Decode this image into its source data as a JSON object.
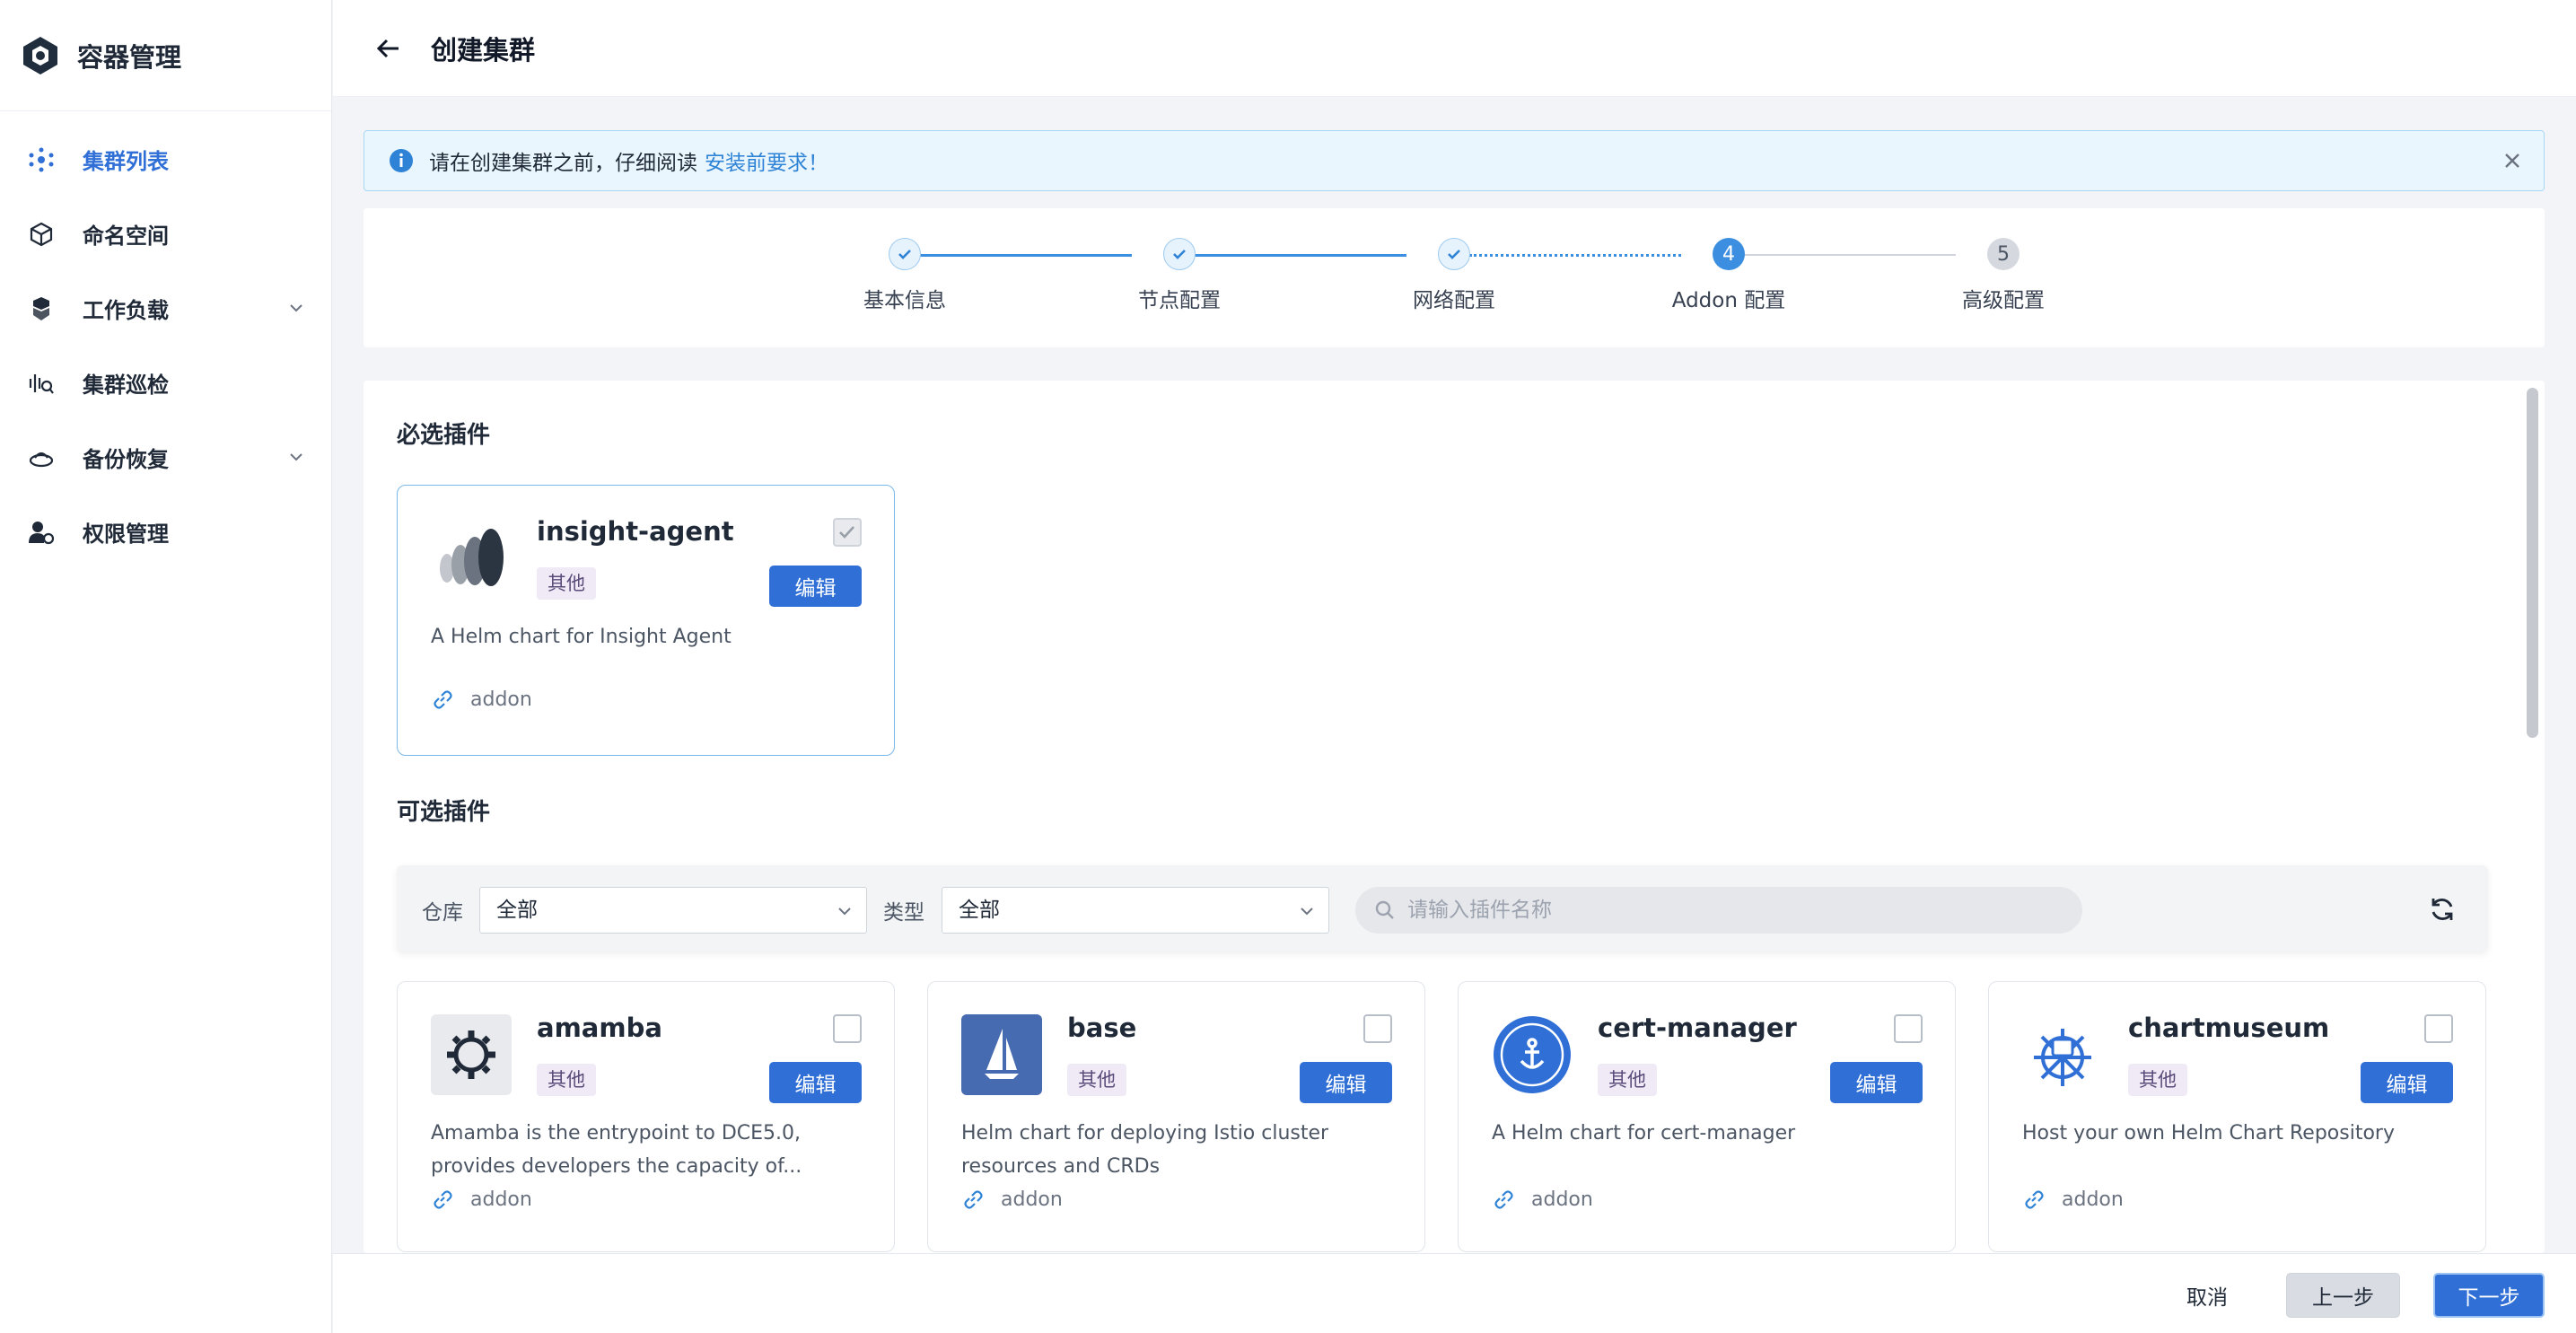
{
  "app": {
    "title": "容器管理"
  },
  "sidebar": {
    "items": [
      {
        "label": "集群列表",
        "icon": "cluster-icon",
        "active": true
      },
      {
        "label": "命名空间",
        "icon": "cube-icon"
      },
      {
        "label": "工作负载",
        "icon": "workload-icon",
        "expandable": true
      },
      {
        "label": "集群巡检",
        "icon": "inspection-icon"
      },
      {
        "label": "备份恢复",
        "icon": "backup-icon",
        "expandable": true
      },
      {
        "label": "权限管理",
        "icon": "user-gear-icon"
      }
    ]
  },
  "header": {
    "title": "创建集群"
  },
  "notice": {
    "text": "请在创建集群之前，仔细阅读",
    "link": "安装前要求！"
  },
  "steps": [
    {
      "label": "基本信息",
      "status": "done",
      "num": ""
    },
    {
      "label": "节点配置",
      "status": "done",
      "num": ""
    },
    {
      "label": "网络配置",
      "status": "done",
      "num": ""
    },
    {
      "label": "Addon 配置",
      "status": "current",
      "num": "4"
    },
    {
      "label": "高级配置",
      "status": "todo",
      "num": "5"
    }
  ],
  "required": {
    "title": "必选插件",
    "card": {
      "name": "insight-agent",
      "tag": "其他",
      "edit": "编辑",
      "desc": "A Helm chart for Insight Agent",
      "repo": "addon",
      "checked": true,
      "disabled": true
    }
  },
  "optional": {
    "title": "可选插件",
    "filter": {
      "repo_label": "仓库",
      "repo_value": "全部",
      "type_label": "类型",
      "type_value": "全部",
      "search_placeholder": "请输入插件名称"
    },
    "cards": [
      {
        "name": "amamba",
        "tag": "其他",
        "edit": "编辑",
        "desc": "Amamba is the entrypoint to DCE5.0, provides developers the capacity of...",
        "repo": "addon"
      },
      {
        "name": "base",
        "tag": "其他",
        "edit": "编辑",
        "desc": "Helm chart for deploying Istio cluster resources and CRDs",
        "repo": "addon"
      },
      {
        "name": "cert-manager",
        "tag": "其他",
        "edit": "编辑",
        "desc": "A Helm chart for cert-manager",
        "repo": "addon"
      },
      {
        "name": "chartmuseum",
        "tag": "其他",
        "edit": "编辑",
        "desc": "Host your own Helm Chart Repository",
        "repo": "addon"
      }
    ]
  },
  "footer": {
    "cancel": "取消",
    "prev": "上一步",
    "next": "下一步"
  },
  "colors": {
    "primary": "#2f6fd6",
    "accent": "#3b8ee0",
    "notice_bg": "#eaf6fd"
  }
}
